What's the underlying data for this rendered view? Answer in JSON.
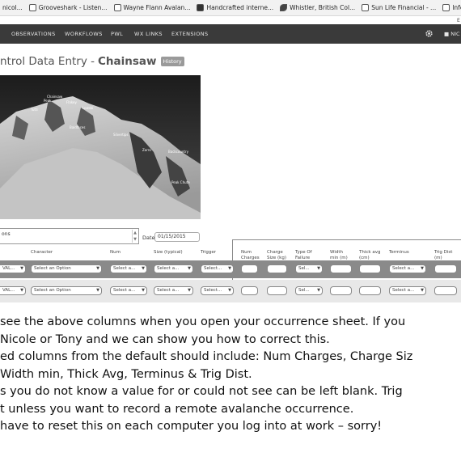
{
  "bookmarks": [
    {
      "label": "nicol...",
      "icon": "page-icon"
    },
    {
      "label": "Grooveshark - Listen...",
      "icon": "grooveshark-icon"
    },
    {
      "label": "Wayne Flann Avalan...",
      "icon": "page-icon"
    },
    {
      "label": "Handcrafted interne...",
      "icon": "flag-icon"
    },
    {
      "label": "Whistler, British Col...",
      "icon": "leaf-icon"
    },
    {
      "label": "Sun Life Financial - ...",
      "icon": "page-icon"
    },
    {
      "label": "InfoEx",
      "icon": "cloud-icon"
    }
  ],
  "nav": {
    "items": [
      "OBSERVATIONS",
      "WORKFLOWS",
      "PWL",
      "WX LINKS",
      "EXTENSIONS"
    ],
    "user_label": "NIC",
    "top_right_letter": "E"
  },
  "page": {
    "title_prefix": "ntrol Data Entry -",
    "title_bold": "Chainsaw",
    "history_button": "History"
  },
  "photo_labels": [
    "Chainsaw",
    "Peak",
    "Flakey",
    "Tutti",
    "Lowski",
    "Baldfaces",
    "Silvertips",
    "Zorro",
    "Backcountry",
    "Peak Chute"
  ],
  "form": {
    "path_value": "ons",
    "date_label": "Date:",
    "date_value": "01/15/2015"
  },
  "columns": [
    {
      "label": "Character",
      "x": 0
    },
    {
      "label": "Num",
      "x": 0
    },
    {
      "label": "Size (typical)",
      "x": 0
    },
    {
      "label": "Trigger",
      "x": 0
    },
    {
      "label": "Num\nCharges",
      "x": 0
    },
    {
      "label": "Charge\nSize (kg)",
      "x": 0
    },
    {
      "label": "Type Of\nFailure",
      "x": 0
    },
    {
      "label": "Width\nmin (m)",
      "x": 0
    },
    {
      "label": "Thick avg\n(cm)",
      "x": 0
    },
    {
      "label": "Terminus",
      "x": 0
    },
    {
      "label": "Trig Dist\n(m)",
      "x": 0
    }
  ],
  "row_placeholders": {
    "first": "VAL...",
    "select_option": "Select an Option",
    "select_short": "Select a...",
    "select_trigger": "Select...",
    "select_fail": "Sel..."
  },
  "instructions": [
    "see the above columns when you open your occurrence sheet. If you",
    " Nicole or Tony and we can show you how to correct this.",
    "ed columns from the default should include: Num Charges, Charge Siz",
    "Width min, Thick Avg, Terminus & Trig Dist.",
    "s you do not know a value for or could not see can be left blank. Trig",
    "t unless you want to record a remote avalanche occurrence.",
    "have to reset this on each computer you log into at work – sorry!"
  ]
}
